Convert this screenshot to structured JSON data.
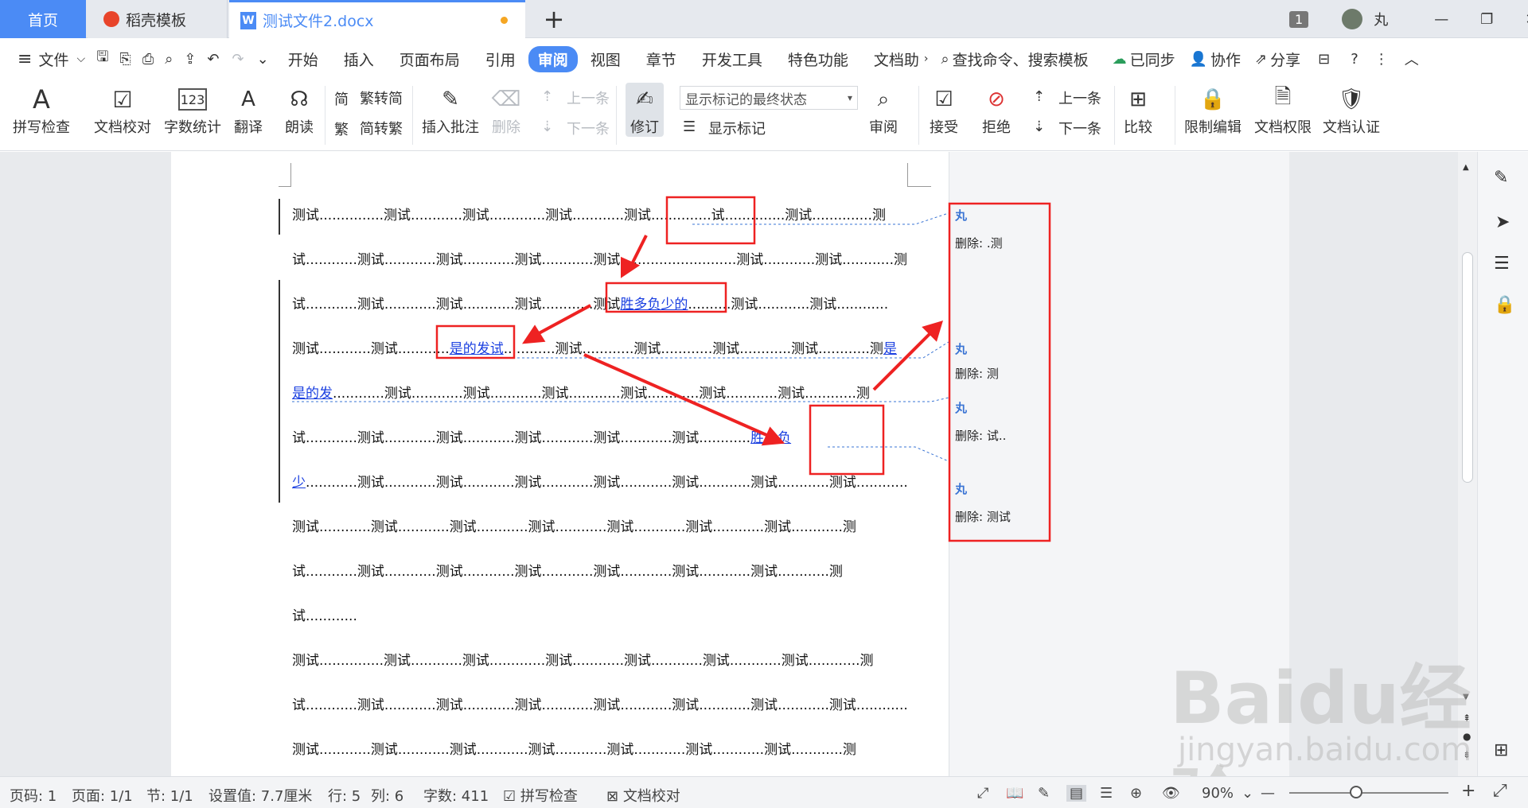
{
  "tabs": {
    "home": "首页",
    "template": "稻壳模板",
    "document": "测试文件2.docx",
    "badge": "1",
    "user": "丸"
  },
  "menu": {
    "file": "文件",
    "items": [
      "开始",
      "插入",
      "页面布局",
      "引用",
      "审阅",
      "视图",
      "章节",
      "开发工具",
      "特色功能",
      "文档助"
    ],
    "search": "查找命令、搜索模板",
    "sync": "已同步",
    "collab": "协作",
    "share": "分享"
  },
  "ribbon": {
    "spell": "拼写检查",
    "proofread": "文档校对",
    "wordcount": "字数统计",
    "translate": "翻译",
    "read": "朗读",
    "trad_simp": "繁转简",
    "simp_trad": "简转繁",
    "insert_comment": "插入批注",
    "delete": "删除",
    "prev_comment": "上一条",
    "next_comment": "下一条",
    "track": "修订",
    "display_state": "显示标记的最终状态",
    "show_markup": "显示标记",
    "review": "审阅",
    "accept": "接受",
    "reject": "拒绝",
    "prev_change": "上一条",
    "next_change": "下一条",
    "compare": "比较",
    "restrict": "限制编辑",
    "permission": "文档权限",
    "certify": "文档认证"
  },
  "document": {
    "lines": [
      "测试...............测试............测试.............测试............测试..............",
      "试............测试............测试............测试............测试............",
      "试............测试............测试............测试............测试",
      "测试............测试............",
      "是的发",
      "试............测试............测试............测试............测试............测试............",
      "少",
      "测试............测试............测试............测试............测试............测试............测试............测",
      "试............测试............测试............测试............测试............测试............测试............测",
      "试............",
      "测试...............测试............测试.............测试............测试............测试............测试............测",
      "试............测试............测试............测试............测试............测试............测试............测试............",
      "测试............测试............测试............测试............测试............测试............测试............测"
    ],
    "line1_tail": "试..............测试..............测",
    "line2_tail": "...............测试............测试............测",
    "insert_a": "胜多负少的",
    "line3_tail": "..........测试............测试............",
    "insert_b": "是的发试",
    "line4_tail": "............测试............测试............测试............测试............测",
    "insert_c": "是",
    "line5_tail": "............测试............测试............测试............测试............测试............测试............测",
    "insert_d": "胜多负",
    "line7_tail": "............测试............测试............测试............测试............测试............测试............测试............"
  },
  "comments": [
    {
      "author": "丸",
      "text": "删除: .测"
    },
    {
      "author": "丸",
      "text": "删除: 测"
    },
    {
      "author": "丸",
      "text": "删除: 试.."
    },
    {
      "author": "丸",
      "text": "删除: 测试"
    }
  ],
  "status": {
    "page_no": "页码: 1",
    "pages": "页面: 1/1",
    "section": "节: 1/1",
    "setting": "设置值: 7.7厘米",
    "row": "行: 5",
    "col": "列: 6",
    "words": "字数: 411",
    "spell": "拼写检查",
    "proof": "文档校对",
    "zoom": "90%"
  },
  "watermark": {
    "main": "Baidu经验",
    "sub": "jingyan.baidu.com"
  }
}
